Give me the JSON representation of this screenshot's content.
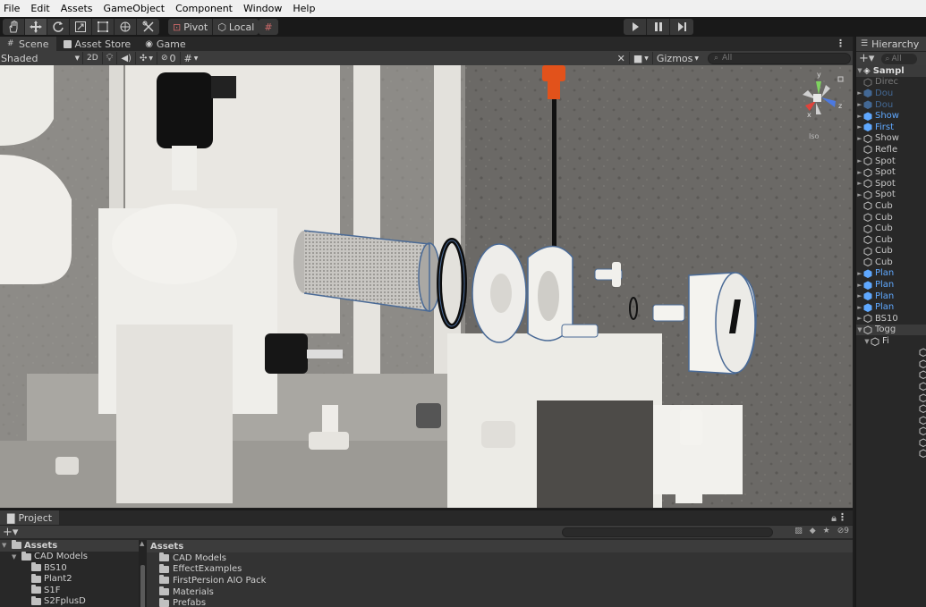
{
  "menu": [
    "File",
    "Edit",
    "Assets",
    "GameObject",
    "Component",
    "Window",
    "Help"
  ],
  "toolbar": {
    "tools": [
      "hand-tool",
      "move-tool",
      "rotate-tool",
      "scale-tool",
      "rect-tool",
      "transform-tool",
      "custom-tool"
    ],
    "pivot_label": "Pivot",
    "local_label": "Local"
  },
  "scene_tabs": [
    {
      "label": "Scene",
      "icon": "scene-icon"
    },
    {
      "label": "Asset Store",
      "icon": "store-icon"
    },
    {
      "label": "Game",
      "icon": "game-icon"
    }
  ],
  "scene_toolbar": {
    "shading_mode": "Shaded",
    "mode_2d": "2D",
    "hidden_count": "0",
    "gizmos_label": "Gizmos",
    "search_placeholder": "All"
  },
  "viewport": {
    "gizmo_label": "Iso",
    "axis_y": "y",
    "axis_z": "z",
    "axis_x": "x"
  },
  "hierarchy": {
    "title": "Hierarchy",
    "search_placeholder": "All",
    "root": "Sampl",
    "items": [
      {
        "label": "Direc",
        "style": "dim",
        "arrow": ""
      },
      {
        "label": "Dou",
        "style": "dim-blue",
        "arrow": "►"
      },
      {
        "label": "Dou",
        "style": "dim-blue",
        "arrow": "►"
      },
      {
        "label": "Show",
        "style": "blue",
        "arrow": "►"
      },
      {
        "label": "First",
        "style": "blue",
        "arrow": "►"
      },
      {
        "label": "Show",
        "style": "normal",
        "arrow": "►"
      },
      {
        "label": "Refle",
        "style": "normal",
        "arrow": ""
      },
      {
        "label": "Spot",
        "style": "normal",
        "arrow": "►"
      },
      {
        "label": "Spot",
        "style": "normal",
        "arrow": "►"
      },
      {
        "label": "Spot",
        "style": "normal",
        "arrow": "►"
      },
      {
        "label": "Spot",
        "style": "normal",
        "arrow": "►"
      },
      {
        "label": "Cub",
        "style": "normal",
        "arrow": ""
      },
      {
        "label": "Cub",
        "style": "normal",
        "arrow": ""
      },
      {
        "label": "Cub",
        "style": "normal",
        "arrow": ""
      },
      {
        "label": "Cub",
        "style": "normal",
        "arrow": ""
      },
      {
        "label": "Cub",
        "style": "normal",
        "arrow": ""
      },
      {
        "label": "Cub",
        "style": "normal",
        "arrow": ""
      },
      {
        "label": "Plan",
        "style": "blue",
        "arrow": "►"
      },
      {
        "label": "Plan",
        "style": "blue",
        "arrow": "►"
      },
      {
        "label": "Plan",
        "style": "blue",
        "arrow": "►"
      },
      {
        "label": "Plan",
        "style": "blue",
        "arrow": "►"
      },
      {
        "label": "BS10",
        "style": "normal",
        "arrow": "►"
      },
      {
        "label": "Togg",
        "style": "selected",
        "arrow": "▼"
      },
      {
        "label": "Fi",
        "style": "child",
        "arrow": "▼"
      }
    ]
  },
  "project": {
    "title": "Project",
    "asset_count": "9",
    "tree": [
      {
        "label": "Assets",
        "level": 0,
        "selected": true
      },
      {
        "label": "CAD Models",
        "level": 1,
        "selected": false
      },
      {
        "label": "BS10",
        "level": 2,
        "selected": false
      },
      {
        "label": "Plant2",
        "level": 2,
        "selected": false
      },
      {
        "label": "S1F",
        "level": 2,
        "selected": false
      },
      {
        "label": "S2FplusD",
        "level": 2,
        "selected": false
      }
    ],
    "assets_header": "Assets",
    "assets": [
      "CAD Models",
      "EffectExamples",
      "FirstPersion AIO Pack",
      "Materials",
      "Prefabs"
    ]
  }
}
